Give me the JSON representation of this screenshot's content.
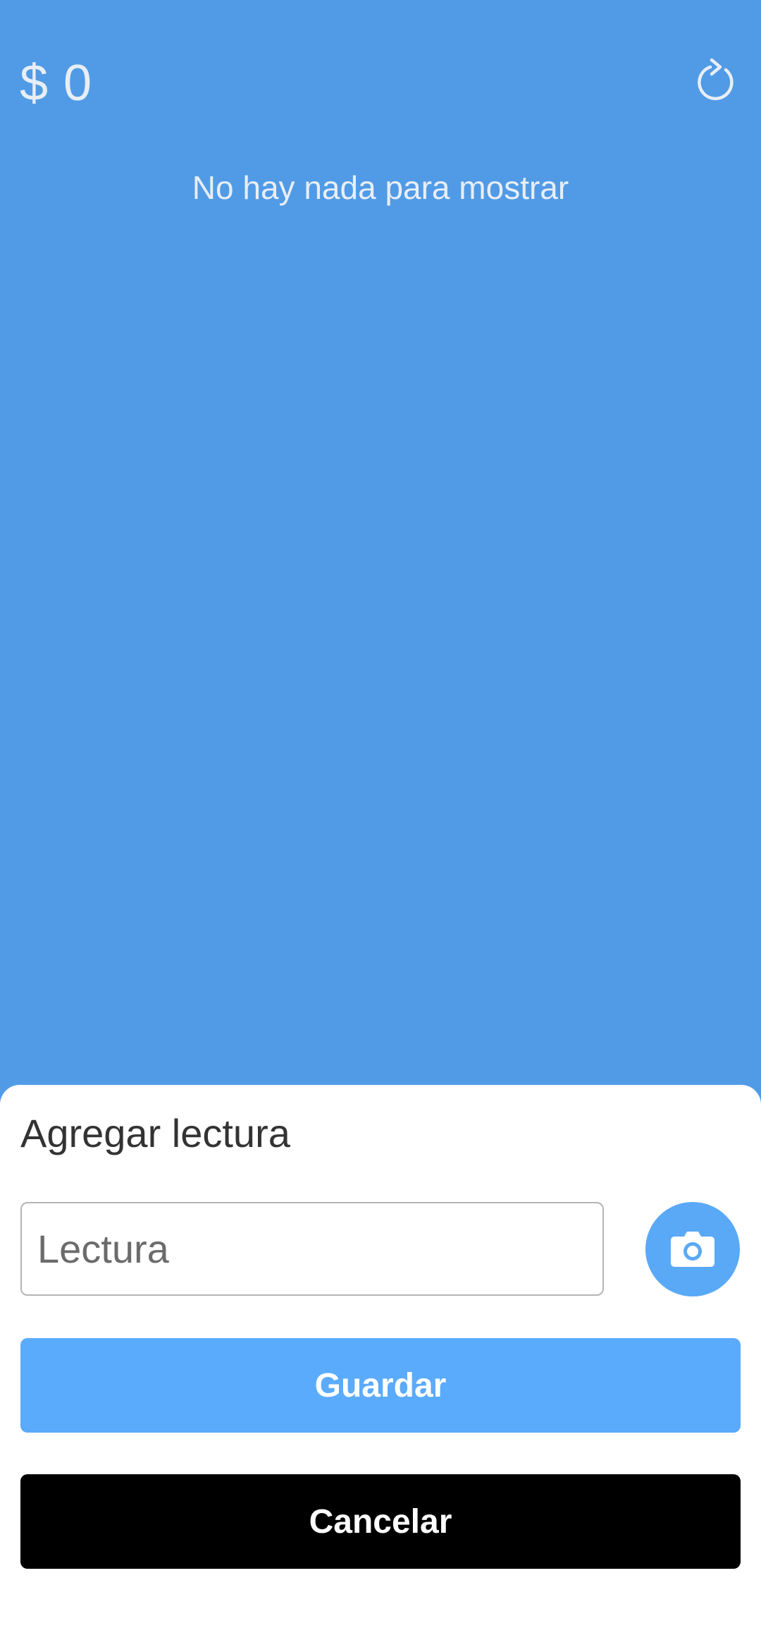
{
  "header": {
    "balance": "$ 0",
    "refresh_icon": "refresh-icon"
  },
  "main": {
    "empty_message": "No hay nada para mostrar"
  },
  "sheet": {
    "title": "Agregar lectura",
    "input_placeholder": "Lectura",
    "input_value": "",
    "camera_icon": "camera-icon",
    "save_label": "Guardar",
    "cancel_label": "Cancelar"
  },
  "colors": {
    "background": "#519be6",
    "primary": "#5aabfc",
    "cancel": "#000000",
    "sheet": "#ffffff"
  }
}
